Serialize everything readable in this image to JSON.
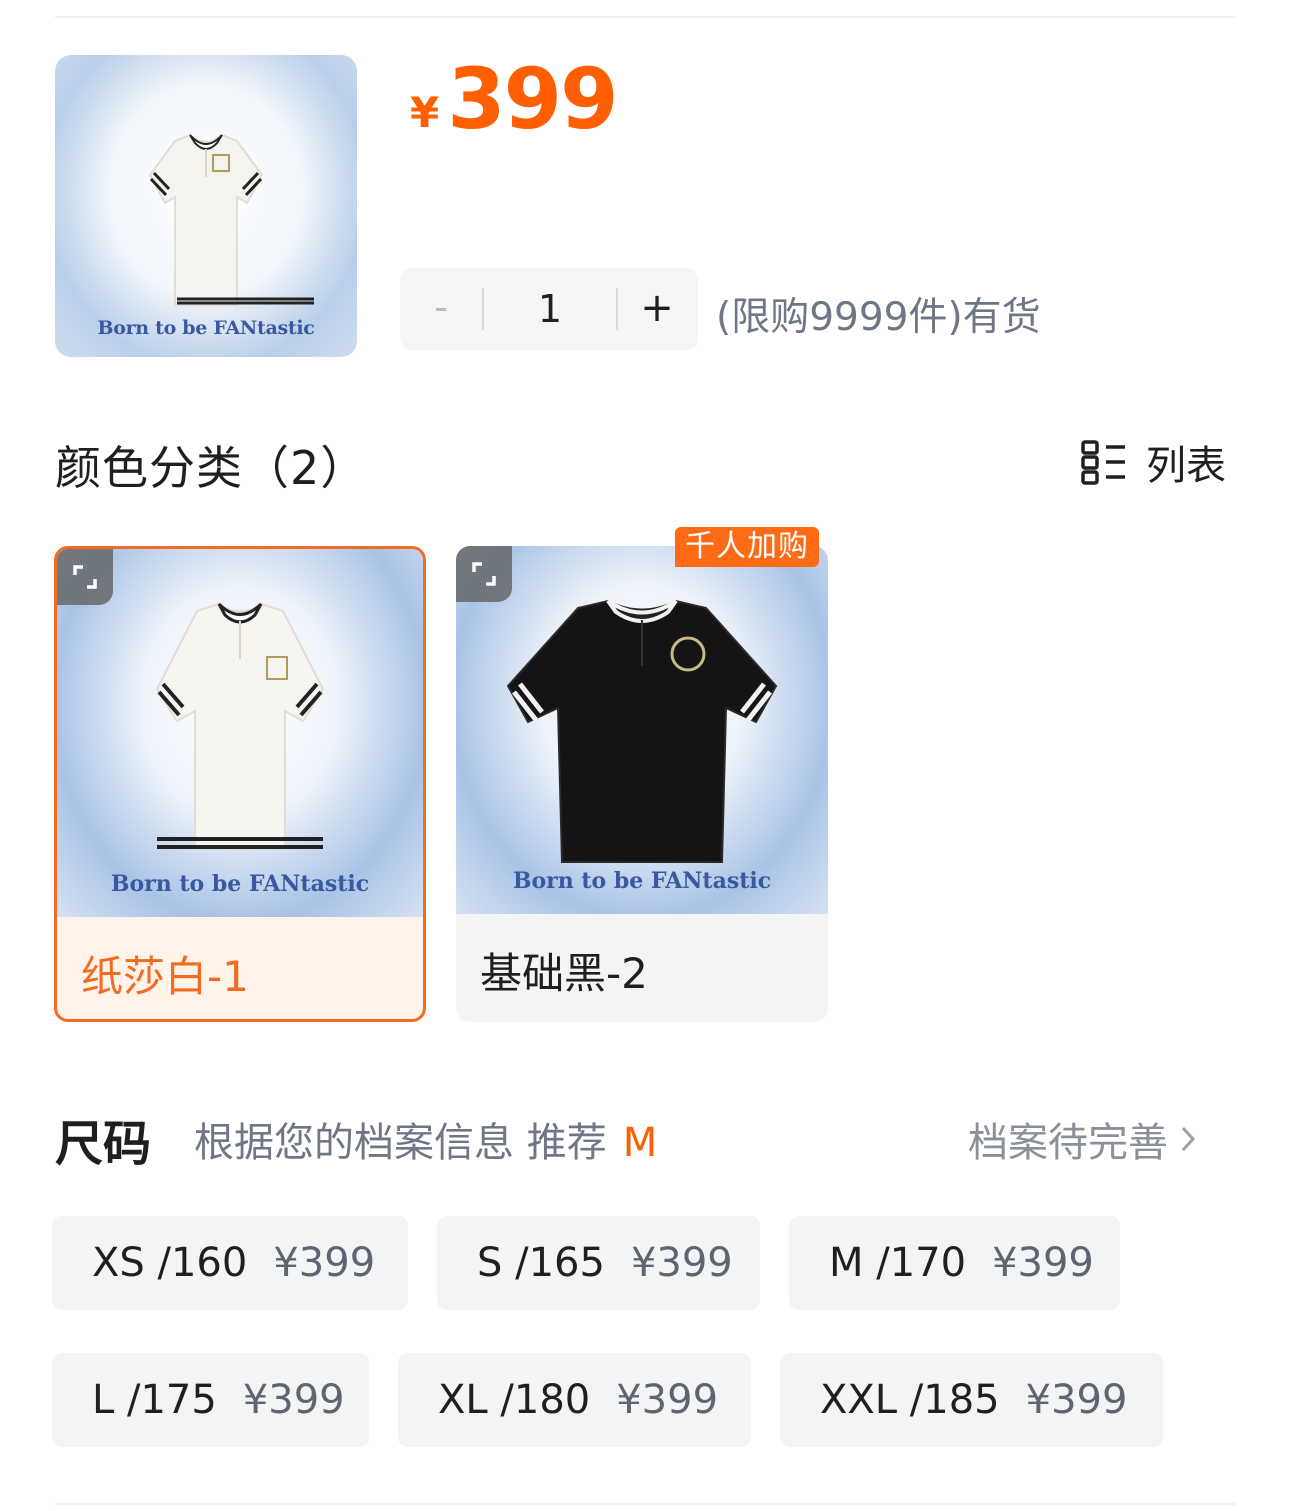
{
  "product": {
    "price_symbol": "¥",
    "price_value": "399",
    "image_caption": "Born to be FANtastic"
  },
  "quantity": {
    "minus_label": "-",
    "value": "1",
    "plus_label": "+",
    "stock_text": "(限购9999件)有货"
  },
  "colors": {
    "title": "颜色分类（2）",
    "list_toggle_label": "列表",
    "items": [
      {
        "name": "纸莎白-1",
        "caption": "Born to be FANtastic",
        "selected": true
      },
      {
        "name": "基础黑-2",
        "caption": "Born to be FANtastic",
        "badge": "千人加购",
        "selected": false
      }
    ]
  },
  "sizes": {
    "title": "尺码",
    "hint": "根据您的档案信息 推荐",
    "recommended": "M",
    "profile_link": "档案待完善",
    "items": [
      {
        "label": "XS /160",
        "price": "¥399"
      },
      {
        "label": "S /165",
        "price": "¥399"
      },
      {
        "label": "M /170",
        "price": "¥399"
      },
      {
        "label": "L /175",
        "price": "¥399"
      },
      {
        "label": "XL /180",
        "price": "¥399"
      },
      {
        "label": "XXL /185",
        "price": "¥399"
      }
    ]
  },
  "theme": {
    "accent": "#ff5f00",
    "selected_border": "#f26b21"
  }
}
